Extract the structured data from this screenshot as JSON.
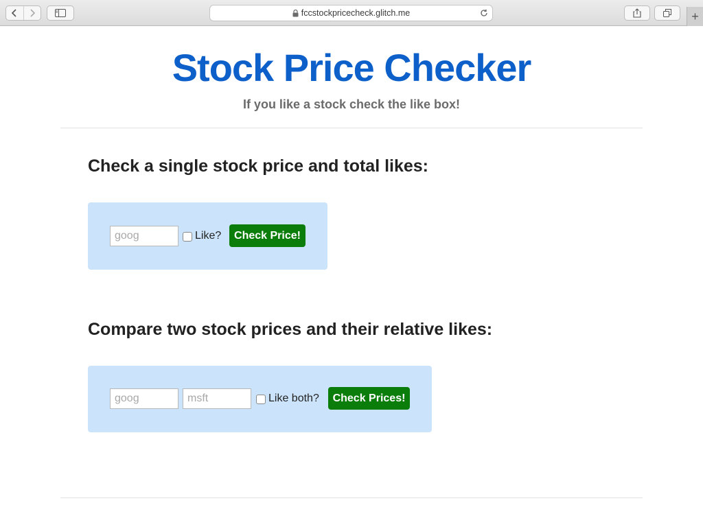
{
  "browser": {
    "url": "fccstockpricecheck.glitch.me",
    "new_tab_symbol": "+"
  },
  "header": {
    "title": "Stock Price Checker",
    "subtitle": "If you like a stock check the like box!"
  },
  "single": {
    "heading": "Check a single stock price and total likes:",
    "stock_placeholder": "goog",
    "like_label": "Like?",
    "button_label": "Check Price!"
  },
  "compare": {
    "heading": "Compare two stock prices and their relative likes:",
    "stock1_placeholder": "goog",
    "stock2_placeholder": "msft",
    "like_label": "Like both?",
    "button_label": "Check Prices!"
  },
  "colors": {
    "title": "#0d5fc9",
    "panel": "#cce4fb",
    "button": "#0b7d0b"
  }
}
